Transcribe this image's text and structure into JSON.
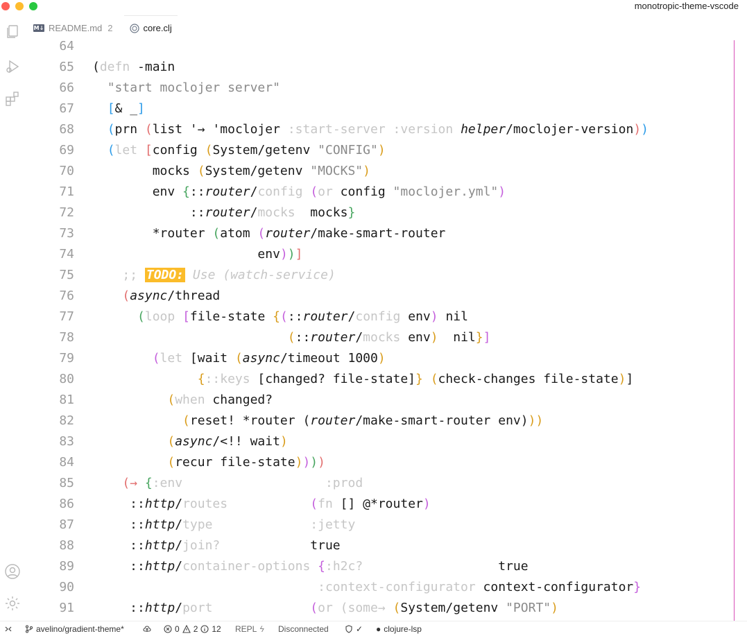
{
  "window": {
    "title": "monotropic-theme-vscode"
  },
  "tabs": [
    {
      "icon": "markdown-icon",
      "icon_text": "M↓",
      "label": "README.md",
      "badge": "2",
      "active": false
    },
    {
      "icon": "clojure-icon",
      "label": "core.clj",
      "active": true
    }
  ],
  "editor": {
    "lines": [
      {
        "n": "64",
        "tokens": []
      },
      {
        "n": "65",
        "tokens": [
          [
            "(",
            "default"
          ],
          [
            "defn",
            "dim"
          ],
          [
            " -main",
            "default"
          ]
        ]
      },
      {
        "n": "66",
        "tokens": [
          [
            "  ",
            "default"
          ],
          [
            "\"start moclojer server\"",
            "gray"
          ]
        ]
      },
      {
        "n": "67",
        "tokens": [
          [
            "  ",
            "default"
          ],
          [
            "[",
            "blue"
          ],
          [
            "& _",
            "default"
          ],
          [
            "]",
            "blue"
          ]
        ]
      },
      {
        "n": "68",
        "tokens": [
          [
            "  ",
            "default"
          ],
          [
            "(",
            "blue"
          ],
          [
            "prn ",
            "default"
          ],
          [
            "(",
            "red"
          ],
          [
            "list '→ 'moclojer ",
            "default"
          ],
          [
            ":start-server :version ",
            "dim"
          ],
          [
            "helper",
            "it"
          ],
          [
            "/moclojer-version",
            "default"
          ],
          [
            ")",
            "red"
          ],
          [
            ")",
            "blue"
          ]
        ]
      },
      {
        "n": "69",
        "tokens": [
          [
            "  ",
            "default"
          ],
          [
            "(",
            "blue"
          ],
          [
            "let ",
            "dim"
          ],
          [
            "[",
            "red"
          ],
          [
            "config ",
            "default"
          ],
          [
            "(",
            "orange"
          ],
          [
            "System/getenv ",
            "default"
          ],
          [
            "\"CONFIG\"",
            "gray"
          ],
          [
            ")",
            "orange"
          ]
        ]
      },
      {
        "n": "70",
        "tokens": [
          [
            "        mocks ",
            "default"
          ],
          [
            "(",
            "orange"
          ],
          [
            "System/getenv ",
            "default"
          ],
          [
            "\"MOCKS\"",
            "gray"
          ],
          [
            ")",
            "orange"
          ]
        ]
      },
      {
        "n": "71",
        "tokens": [
          [
            "        env ",
            "default"
          ],
          [
            "{",
            "green"
          ],
          [
            "::",
            "default"
          ],
          [
            "router",
            "it"
          ],
          [
            "/",
            "default"
          ],
          [
            "config ",
            "dim"
          ],
          [
            "(",
            "violet"
          ],
          [
            "or",
            "dim"
          ],
          [
            " config ",
            "default"
          ],
          [
            "\"moclojer.yml\"",
            "gray"
          ],
          [
            ")",
            "violet"
          ]
        ]
      },
      {
        "n": "72",
        "tokens": [
          [
            "             ::",
            "default"
          ],
          [
            "router",
            "it"
          ],
          [
            "/",
            "default"
          ],
          [
            "mocks",
            "dim"
          ],
          [
            "  mocks",
            "default"
          ],
          [
            "}",
            "green"
          ]
        ]
      },
      {
        "n": "73",
        "tokens": [
          [
            "        *router ",
            "default"
          ],
          [
            "(",
            "green"
          ],
          [
            "atom ",
            "default"
          ],
          [
            "(",
            "violet"
          ],
          [
            "router",
            "it"
          ],
          [
            "/make-smart-router",
            "default"
          ]
        ]
      },
      {
        "n": "74",
        "tokens": [
          [
            "                      env",
            "default"
          ],
          [
            ")",
            "violet"
          ],
          [
            ")",
            "green"
          ],
          [
            "]",
            "red"
          ]
        ]
      },
      {
        "n": "75",
        "tokens": [
          [
            "    ",
            "default"
          ],
          [
            ";; ",
            "dim"
          ],
          [
            "TODO:",
            "todo"
          ],
          [
            " Use (watch-service)",
            "dimit"
          ]
        ]
      },
      {
        "n": "76",
        "tokens": [
          [
            "    ",
            "default"
          ],
          [
            "(",
            "red"
          ],
          [
            "async",
            "it"
          ],
          [
            "/thread",
            "default"
          ]
        ]
      },
      {
        "n": "77",
        "tokens": [
          [
            "      ",
            "default"
          ],
          [
            "(",
            "green"
          ],
          [
            "loop ",
            "dim"
          ],
          [
            "[",
            "violet"
          ],
          [
            "file-state ",
            "default"
          ],
          [
            "{",
            "orange"
          ],
          [
            "(",
            "violet"
          ],
          [
            "::",
            "default"
          ],
          [
            "router",
            "it"
          ],
          [
            "/",
            "default"
          ],
          [
            "config",
            "dim"
          ],
          [
            " env",
            "default"
          ],
          [
            ")",
            "violet"
          ],
          [
            " nil",
            "default"
          ]
        ]
      },
      {
        "n": "78",
        "tokens": [
          [
            "                          ",
            "default"
          ],
          [
            "(",
            "orange"
          ],
          [
            "::",
            "default"
          ],
          [
            "router",
            "it"
          ],
          [
            "/",
            "default"
          ],
          [
            "mocks",
            "dim"
          ],
          [
            " env",
            "default"
          ],
          [
            ")",
            "orange"
          ],
          [
            "  nil",
            "default"
          ],
          [
            "}",
            "orange"
          ],
          [
            "]",
            "violet"
          ]
        ]
      },
      {
        "n": "79",
        "tokens": [
          [
            "        ",
            "default"
          ],
          [
            "(",
            "violet"
          ],
          [
            "let ",
            "dim"
          ],
          [
            "[",
            "default"
          ],
          [
            "wait ",
            "default"
          ],
          [
            "(",
            "orange"
          ],
          [
            "async",
            "it"
          ],
          [
            "/timeout 1000",
            "default"
          ],
          [
            ")",
            "orange"
          ]
        ]
      },
      {
        "n": "80",
        "tokens": [
          [
            "              ",
            "default"
          ],
          [
            "{",
            "orange"
          ],
          [
            "::keys ",
            "dim"
          ],
          [
            "[changed? file-state]",
            "default"
          ],
          [
            "}",
            "orange"
          ],
          [
            " ",
            "default"
          ],
          [
            "(",
            "orange"
          ],
          [
            "check-changes file-state",
            "default"
          ],
          [
            ")",
            "orange"
          ],
          [
            "]",
            "default"
          ]
        ]
      },
      {
        "n": "81",
        "tokens": [
          [
            "          ",
            "default"
          ],
          [
            "(",
            "orange"
          ],
          [
            "when",
            "dim"
          ],
          [
            " changed?",
            "default"
          ]
        ]
      },
      {
        "n": "82",
        "tokens": [
          [
            "            ",
            "default"
          ],
          [
            "(",
            "orange"
          ],
          [
            "reset! *router ",
            "default"
          ],
          [
            "(",
            "default"
          ],
          [
            "router",
            "it"
          ],
          [
            "/make-smart-router env",
            "default"
          ],
          [
            ")",
            "default"
          ],
          [
            ")",
            "orange"
          ],
          [
            ")",
            "orange"
          ]
        ]
      },
      {
        "n": "83",
        "tokens": [
          [
            "          ",
            "default"
          ],
          [
            "(",
            "orange"
          ],
          [
            "async",
            "it"
          ],
          [
            "/<!! wait",
            "default"
          ],
          [
            ")",
            "orange"
          ]
        ]
      },
      {
        "n": "84",
        "tokens": [
          [
            "          ",
            "default"
          ],
          [
            "(",
            "orange"
          ],
          [
            "recur file-state",
            "default"
          ],
          [
            ")",
            "orange"
          ],
          [
            ")",
            "violet"
          ],
          [
            ")",
            "green"
          ],
          [
            ")",
            "red"
          ]
        ]
      },
      {
        "n": "85",
        "tokens": [
          [
            "    ",
            "default"
          ],
          [
            "(→ ",
            "red"
          ],
          [
            "{",
            "green"
          ],
          [
            ":env                   :prod",
            "dim"
          ]
        ]
      },
      {
        "n": "86",
        "tokens": [
          [
            "     ::",
            "default"
          ],
          [
            "http",
            "it"
          ],
          [
            "/",
            "default"
          ],
          [
            "routes           ",
            "dim"
          ],
          [
            "(",
            "violet"
          ],
          [
            "fn",
            "dim"
          ],
          [
            " [] @*router",
            "default"
          ],
          [
            ")",
            "violet"
          ]
        ]
      },
      {
        "n": "87",
        "tokens": [
          [
            "     ::",
            "default"
          ],
          [
            "http",
            "it"
          ],
          [
            "/",
            "default"
          ],
          [
            "type             :jetty",
            "dim"
          ]
        ]
      },
      {
        "n": "88",
        "tokens": [
          [
            "     ::",
            "default"
          ],
          [
            "http",
            "it"
          ],
          [
            "/",
            "default"
          ],
          [
            "join?            ",
            "dim"
          ],
          [
            "true",
            "default"
          ]
        ]
      },
      {
        "n": "89",
        "tokens": [
          [
            "     ::",
            "default"
          ],
          [
            "http",
            "it"
          ],
          [
            "/",
            "default"
          ],
          [
            "container-options ",
            "dim"
          ],
          [
            "{",
            "violet"
          ],
          [
            ":h2c?",
            "dim"
          ],
          [
            "                  true",
            "default"
          ]
        ]
      },
      {
        "n": "90",
        "tokens": [
          [
            "                              ",
            "default"
          ],
          [
            ":context-configurator",
            "dim"
          ],
          [
            " context-configurator",
            "default"
          ],
          [
            "}",
            "violet"
          ]
        ]
      },
      {
        "n": "91",
        "tokens": [
          [
            "     ::",
            "default"
          ],
          [
            "http",
            "it"
          ],
          [
            "/",
            "default"
          ],
          [
            "port             ",
            "dim"
          ],
          [
            "(",
            "violet"
          ],
          [
            "or ",
            "dim"
          ],
          [
            "(",
            "dim"
          ],
          [
            "some→ ",
            "dim"
          ],
          [
            "(",
            "orange"
          ],
          [
            "System/getenv ",
            "default"
          ],
          [
            "\"PORT\"",
            "gray"
          ],
          [
            ")",
            "orange"
          ]
        ]
      }
    ]
  },
  "statusbar": {
    "branch": "avelino/gradient-theme*",
    "errors": "0",
    "warnings": "2",
    "info": "12",
    "repl": "REPL",
    "connection": "Disconnected",
    "lsp": "clojure-lsp"
  },
  "colors": {
    "accent_ruler": "#d94fb8",
    "todo_bg": "#fbbc2a",
    "paren_blue": "#2b9be8",
    "paren_red": "#e26d6d",
    "paren_violet": "#c45fdc",
    "paren_green": "#45a45d",
    "paren_orange": "#d99c1a"
  }
}
